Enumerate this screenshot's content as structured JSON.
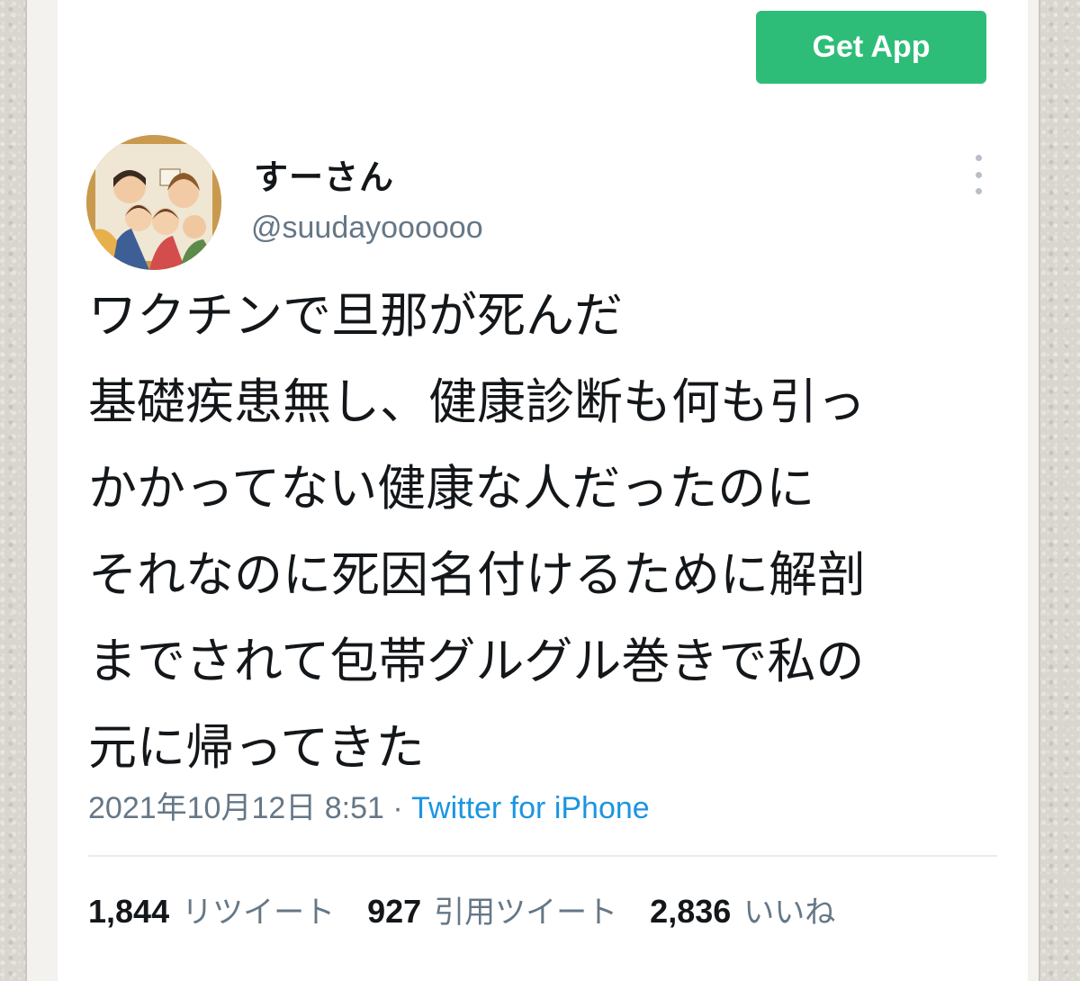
{
  "header": {
    "get_app_label": "Get App"
  },
  "user": {
    "display_name": "すーさん",
    "handle": "@suudayoooooo",
    "avatar_icon": "profile-photo"
  },
  "tweet": {
    "text": "ワクチンで旦那が死んだ\n基礎疾患無し、健康診断も何も引っ\nかかってない健康な人だったのに\nそれなのに死因名付けるために解剖\nまでされて包帯グルグル巻きで私の\n元に帰ってきた",
    "timestamp": "2021年10月12日 8:51",
    "separator": " · ",
    "source": "Twitter for iPhone"
  },
  "stats": {
    "retweets_count": "1,844",
    "retweets_label": "リツイート",
    "quotes_count": "927",
    "quotes_label": "引用ツイート",
    "likes_count": "2,836",
    "likes_label": "いいね"
  },
  "colors": {
    "get_app_button": "#2ebd79",
    "link_blue": "#1b95e0",
    "secondary_text": "#657786",
    "primary_text": "#14171a"
  }
}
